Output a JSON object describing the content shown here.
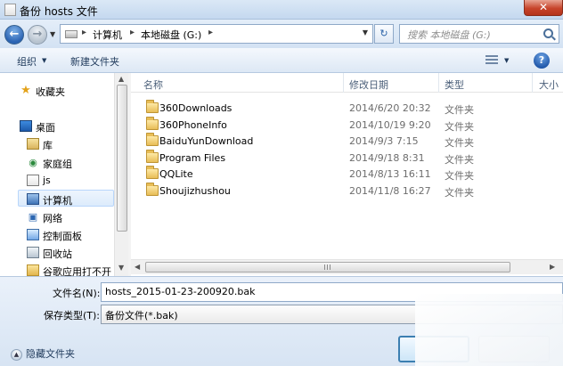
{
  "window": {
    "title": "备份 hosts 文件",
    "close_label": "✕"
  },
  "nav": {
    "back_icon": "arrow-left-icon",
    "forward_icon": "arrow-right-icon",
    "breadcrumb": [
      "计算机",
      "本地磁盘 (G:)"
    ],
    "search_placeholder": "搜索 本地磁盘 (G:)"
  },
  "toolbar": {
    "organize_label": "组织",
    "new_folder_label": "新建文件夹",
    "help_label": "?"
  },
  "sidebar": {
    "items": [
      {
        "label": "收藏夹",
        "icon": "star-icon"
      },
      {
        "label": "桌面",
        "icon": "desktop-icon"
      },
      {
        "label": "库",
        "icon": "library-icon"
      },
      {
        "label": "家庭组",
        "icon": "homegroup-icon"
      },
      {
        "label": "js",
        "icon": "user-icon"
      },
      {
        "label": "计算机",
        "icon": "computer-icon"
      },
      {
        "label": "网络",
        "icon": "network-icon"
      },
      {
        "label": "控制面板",
        "icon": "control-panel-icon"
      },
      {
        "label": "回收站",
        "icon": "recycle-bin-icon"
      },
      {
        "label": "谷歌应用打不开",
        "icon": "folder-icon"
      }
    ]
  },
  "file_list": {
    "columns": [
      "名称",
      "修改日期",
      "类型",
      "大小"
    ],
    "rows": [
      {
        "name": "360Downloads",
        "date": "2014/6/20 20:32",
        "type": "文件夹"
      },
      {
        "name": "360PhoneInfo",
        "date": "2014/10/19 9:20",
        "type": "文件夹"
      },
      {
        "name": "BaiduYunDownload",
        "date": "2014/9/3 7:15",
        "type": "文件夹"
      },
      {
        "name": "Program Files",
        "date": "2014/9/18 8:31",
        "type": "文件夹"
      },
      {
        "name": "QQLite",
        "date": "2014/8/13 16:11",
        "type": "文件夹"
      },
      {
        "name": "Shoujizhushou",
        "date": "2014/11/8 16:27",
        "type": "文件夹"
      }
    ]
  },
  "form": {
    "filename_label": "文件名(N):",
    "filename_value": "hosts_2015-01-23-200920.bak",
    "filetype_label": "保存类型(T):",
    "filetype_value": "备份文件(*.bak)",
    "hide_folders_label": "隐藏文件夹"
  }
}
